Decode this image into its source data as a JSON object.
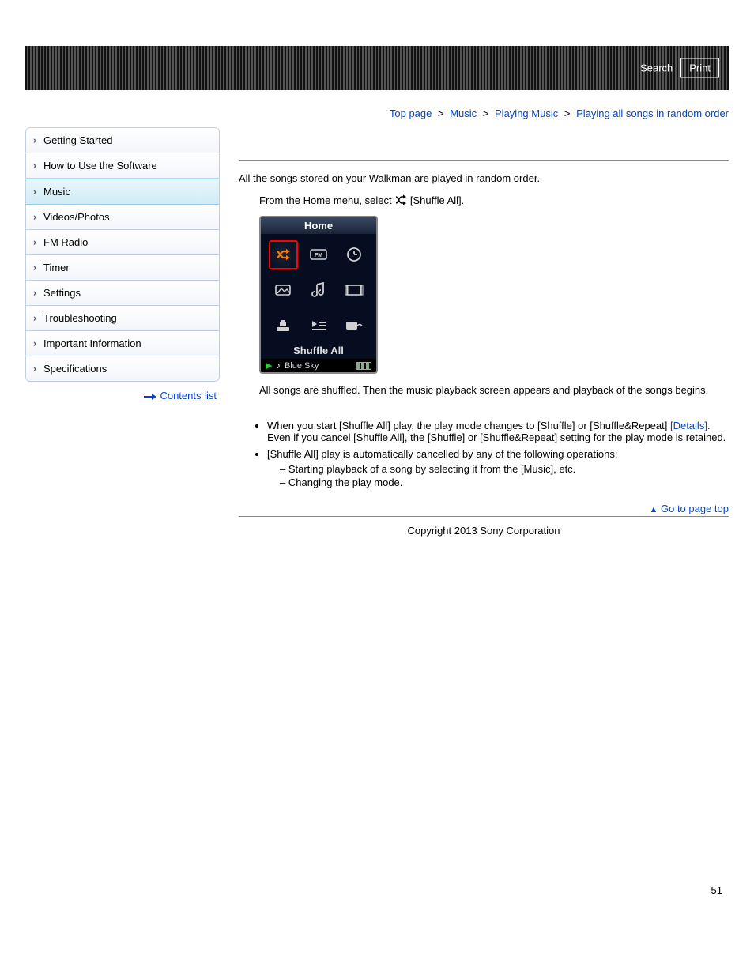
{
  "header": {
    "search": "Search",
    "print": "Print"
  },
  "breadcrumb": {
    "items": [
      "Top page",
      "Music",
      "Playing Music",
      "Playing all songs in random order"
    ],
    "sep": ">"
  },
  "sidebar": {
    "items": [
      {
        "label": "Getting Started",
        "active": false
      },
      {
        "label": "How to Use the Software",
        "active": false
      },
      {
        "label": "Music",
        "active": true
      },
      {
        "label": "Videos/Photos",
        "active": false
      },
      {
        "label": "FM Radio",
        "active": false
      },
      {
        "label": "Timer",
        "active": false
      },
      {
        "label": "Settings",
        "active": false
      },
      {
        "label": "Troubleshooting",
        "active": false
      },
      {
        "label": "Important Information",
        "active": false
      },
      {
        "label": "Specifications",
        "active": false
      }
    ],
    "contents_list": "Contents list"
  },
  "content": {
    "intro": "All the songs stored on your Walkman are played in random order.",
    "instruction_prefix": "From the Home menu, select ",
    "instruction_suffix": " [Shuffle All].",
    "device": {
      "title": "Home",
      "shuffle_label": "Shuffle All",
      "now_playing": "Blue Sky"
    },
    "result": "All songs are shuffled. Then the music playback screen appears and playback of the songs begins.",
    "bullets": [
      {
        "pre": "When you start [Shuffle All] play, the play mode changes to [Shuffle] or [Shuffle&Repeat] ",
        "link": "[Details]",
        "post": ". Even if you cancel [Shuffle All], the [Shuffle] or [Shuffle&Repeat] setting for the play mode is retained."
      },
      {
        "text": "[Shuffle All] play is automatically cancelled by any of the following operations:",
        "subs": [
          "Starting playback of a song by selecting it from the [Music], etc.",
          "Changing the play mode."
        ]
      }
    ],
    "go_top": "Go to page top"
  },
  "footer": {
    "copyright": "Copyright 2013 Sony Corporation"
  },
  "page_number": "51"
}
